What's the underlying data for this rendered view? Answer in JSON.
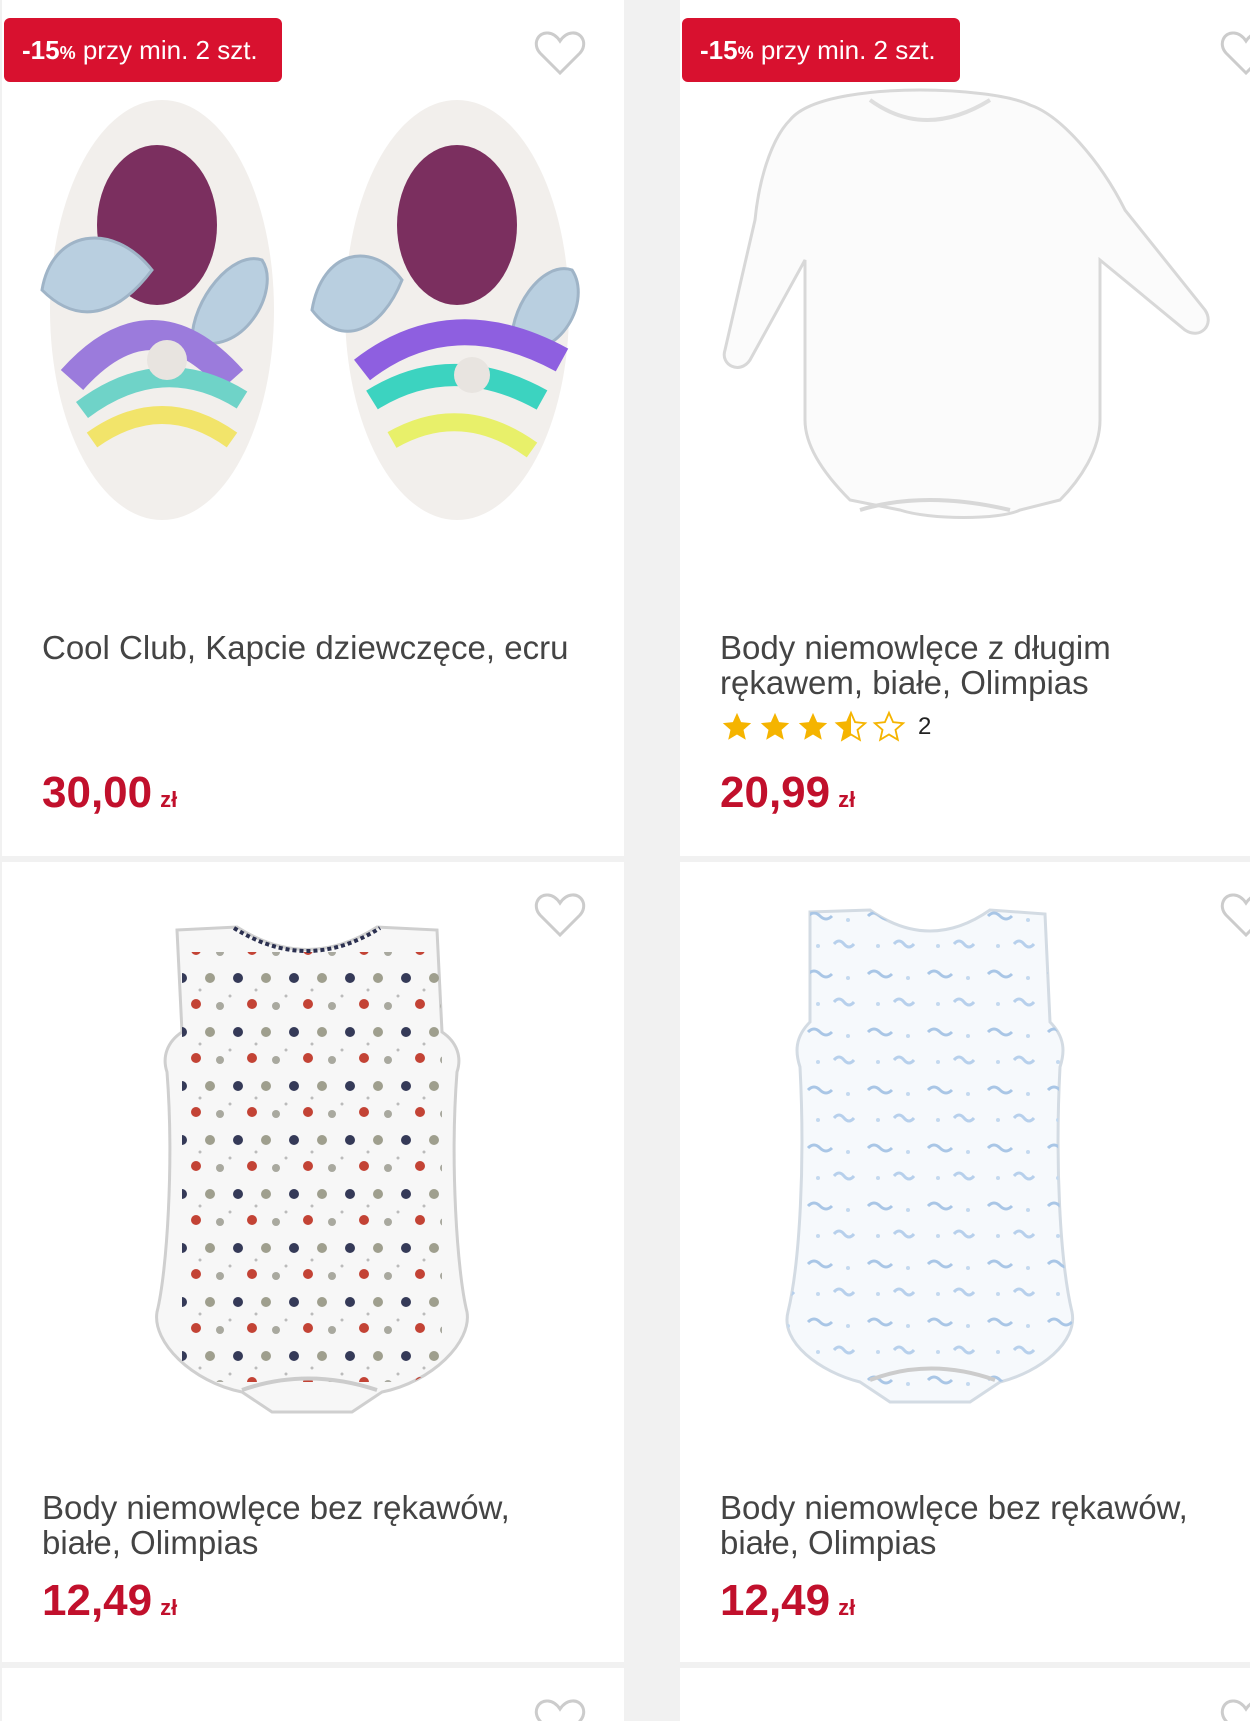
{
  "colors": {
    "accent": "#d8112f",
    "price": "#c1102c",
    "star": "#f5b400"
  },
  "products": [
    {
      "badge_pct": "-15",
      "badge_pct_sign": "%",
      "badge_text": "przy min. 2 szt.",
      "title": "Cool Club, Kapcie dziewczęce, ecru",
      "price": "30,00",
      "currency": "zł",
      "image": "fluffy-unicorn-slippers"
    },
    {
      "badge_pct": "-15",
      "badge_pct_sign": "%",
      "badge_text": "przy min. 2 szt.",
      "title": "Body niemowlęce z długim rękawem, białe, Olimpias",
      "rating": 3.5,
      "rating_count": "2",
      "price": "20,99",
      "currency": "zł",
      "image": "white-long-sleeve-bodysuit"
    },
    {
      "title": "Body niemowlęce bez rękawów, białe, Olimpias",
      "price": "12,49",
      "currency": "zł",
      "image": "sleeveless-dotted-bodysuit"
    },
    {
      "title": "Body niemowlęce bez rękawów, białe, Olimpias",
      "price": "12,49",
      "currency": "zł",
      "image": "sleeveless-blue-print-bodysuit"
    }
  ]
}
